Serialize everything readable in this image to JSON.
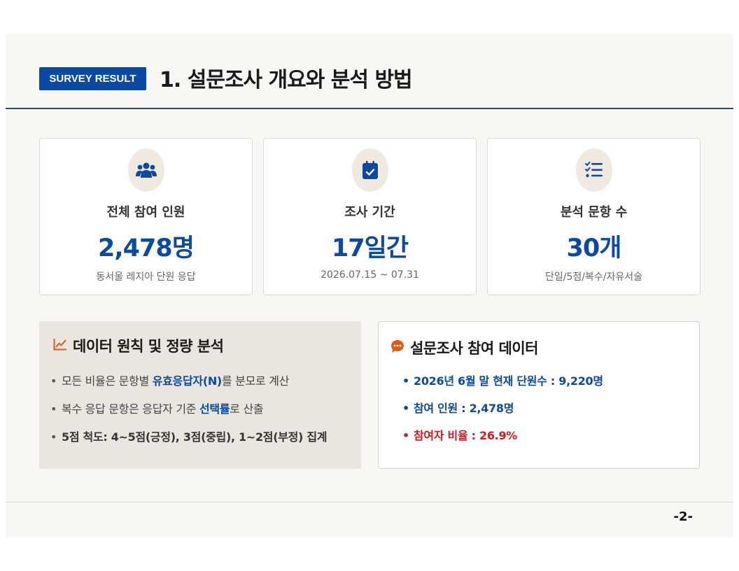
{
  "header": {
    "badge": "SURVEY RESULT",
    "title": "1. 설문조사 개요와 분석 방법"
  },
  "cards": [
    {
      "icon": "users-icon",
      "label": "전체 참여 인원",
      "value": "2,478명",
      "sub": "동서울 레지아 단원 응답"
    },
    {
      "icon": "calendar-check-icon",
      "label": "조사 기간",
      "value": "17일간",
      "sub": "2026.07.15 ~ 07.31"
    },
    {
      "icon": "checklist-icon",
      "label": "분석 문항 수",
      "value": "30개",
      "sub": "단일/5점/복수/자유서술"
    }
  ],
  "principles": {
    "icon": "line-chart-icon",
    "title": "데이터 원칙 및 정량 분석",
    "items": [
      {
        "pre": "모든 비율은 문항별 ",
        "em": "유효응답자(N)",
        "post": "를 분모로 계산"
      },
      {
        "pre": "복수 응답 문항은 응답자 기준 ",
        "em": "선택률",
        "post": "로 산출"
      },
      {
        "text": "5점 척도: 4~5점(긍정), 3점(중립), 1~2점(부정) 집계"
      }
    ]
  },
  "participation": {
    "icon": "chat-bubble-icon",
    "title": "설문조사 참여 데이터",
    "items": [
      "2026년 6월 말 현재 단원수 : 9,220명",
      "참여 인원 : 2,478명",
      "참여자 비율 : 26.9%"
    ]
  },
  "footer": {
    "page": "-2-"
  },
  "colors": {
    "accent": "#0a4aa3",
    "highlight_red": "#e0141e",
    "orange_icon": "#e05a14"
  }
}
